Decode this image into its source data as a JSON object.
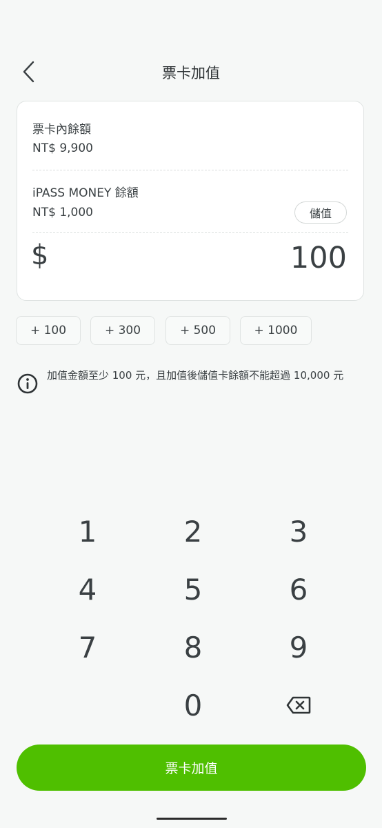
{
  "header": {
    "back_icon": "chevron-left-icon",
    "title": "票卡加值"
  },
  "card": {
    "balance_label": "票卡內餘額",
    "balance_value": "NT$ 9,900",
    "ipass_label": "iPASS MONEY 餘額",
    "ipass_value": "NT$ 1,000",
    "topup_label": "儲值",
    "currency_symbol": "$",
    "amount": "100"
  },
  "quick_amounts": [
    "+ 100",
    "+ 300",
    "+ 500",
    "+ 1000"
  ],
  "notice": {
    "icon": "info-icon",
    "text": "加值金額至少 100 元，且加值後儲值卡餘額不能超過 10,000 元"
  },
  "keypad": {
    "keys": [
      "1",
      "2",
      "3",
      "4",
      "5",
      "6",
      "7",
      "8",
      "9",
      "0"
    ],
    "backspace_icon": "backspace-icon"
  },
  "submit": {
    "label": "票卡加值"
  },
  "colors": {
    "primary": "#4fbf00",
    "background": "#f6f8f7",
    "text": "#3a4043"
  }
}
